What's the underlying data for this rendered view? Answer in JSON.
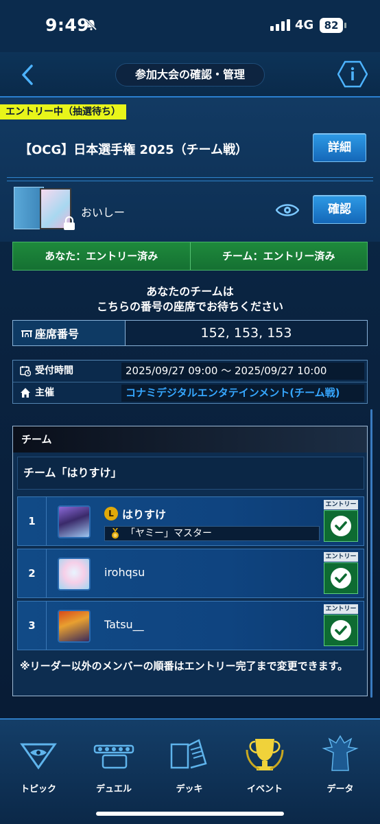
{
  "status_bar": {
    "time": "9:49",
    "network": "4G",
    "battery": "82"
  },
  "header": {
    "title": "参加大会の確認・管理"
  },
  "event": {
    "badge": "エントリー中（抽選待ち）",
    "name": "【OCG】日本選手権 2025（チーム戦）",
    "detail_button": "詳細",
    "deck_name": "おいしー",
    "confirm_button": "確認"
  },
  "entry_status": {
    "you": "あなた：エントリー済み",
    "team": "チーム：エントリー済み"
  },
  "wait_message": {
    "line1": "あなたのチームは",
    "line2": "こちらの番号の座席でお待ちください"
  },
  "seat": {
    "label": "座席番号",
    "value": "152, 153, 153"
  },
  "info": {
    "reception_label": "受付時間",
    "reception_value": "2025/09/27 09:00 〜 2025/09/27 10:00",
    "organizer_label": "主催",
    "organizer_value": "コナミデジタルエンタテインメント(チーム戦)"
  },
  "team": {
    "header": "チーム",
    "name": "チーム「はりすけ」",
    "members": [
      {
        "num": "1",
        "name": "はりすけ",
        "leader_mark": "L",
        "title": "「ヤミー」マスター",
        "entry_tag": "エントリー"
      },
      {
        "num": "2",
        "name": "irohqsu",
        "entry_tag": "エントリー"
      },
      {
        "num": "3",
        "name": "Tatsu__",
        "entry_tag": "エントリー"
      }
    ],
    "note": "※リーダー以外のメンバーの順番はエントリー完了まで変更できます。"
  },
  "nav": [
    {
      "label": "トピック",
      "icon": "millennium-eye-icon"
    },
    {
      "label": "デュエル",
      "icon": "duel-disk-icon"
    },
    {
      "label": "デッキ",
      "icon": "deck-cards-icon"
    },
    {
      "label": "イベント",
      "icon": "trophy-icon"
    },
    {
      "label": "データ",
      "icon": "character-silhouette-icon"
    }
  ],
  "colors": {
    "accent": "#2e9be6",
    "badge": "#e8f51a",
    "entry_green": "#1e8a3c",
    "link": "#36a7ff"
  }
}
